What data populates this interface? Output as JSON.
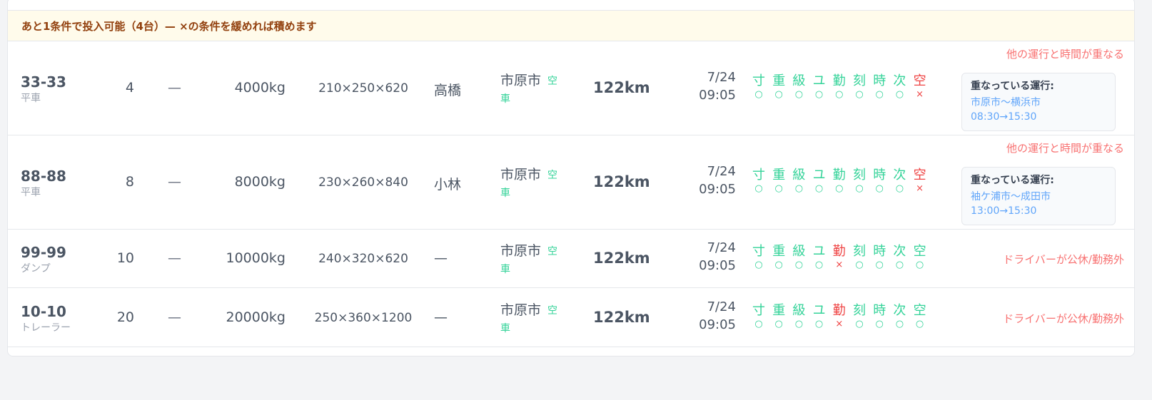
{
  "banner": "あと1条件で投入可能（4台）— ×の条件を緩めれば積めます",
  "check_labels": [
    "寸",
    "重",
    "級",
    "ユ",
    "勤",
    "刻",
    "時",
    "次",
    "空"
  ],
  "colors": {
    "ok": "#34d399",
    "ng": "#ef4444",
    "reason": "#f87171",
    "banner_bg": "#fffbeb"
  },
  "rows": [
    {
      "plate": "33-33",
      "type": "平車",
      "count": "4",
      "dash": "—",
      "weight": "4000kg",
      "dims": "210×250×620",
      "driver": "高橋",
      "city": "市原市",
      "status1": "空",
      "status2": "車",
      "distance": "122km",
      "date": "7/24",
      "time": "09:05",
      "checks": [
        "ok",
        "ok",
        "ok",
        "ok",
        "ok",
        "ok",
        "ok",
        "ok",
        "ng"
      ],
      "marks": [
        "○",
        "○",
        "○",
        "○",
        "○",
        "○",
        "○",
        "○",
        "×"
      ],
      "reason": "他の運行と時間が重なる",
      "conflict": {
        "heading": "重なっている運行:",
        "route": "市原市～横浜市",
        "time": "08:30→15:30"
      }
    },
    {
      "plate": "88-88",
      "type": "平車",
      "count": "8",
      "dash": "—",
      "weight": "8000kg",
      "dims": "230×260×840",
      "driver": "小林",
      "city": "市原市",
      "status1": "空",
      "status2": "車",
      "distance": "122km",
      "date": "7/24",
      "time": "09:05",
      "checks": [
        "ok",
        "ok",
        "ok",
        "ok",
        "ok",
        "ok",
        "ok",
        "ok",
        "ng"
      ],
      "marks": [
        "○",
        "○",
        "○",
        "○",
        "○",
        "○",
        "○",
        "○",
        "×"
      ],
      "reason": "他の運行と時間が重なる",
      "conflict": {
        "heading": "重なっている運行:",
        "route": "袖ケ浦市～成田市",
        "time": "13:00→15:30"
      }
    },
    {
      "plate": "99-99",
      "type": "ダンプ",
      "count": "10",
      "dash": "—",
      "weight": "10000kg",
      "dims": "240×320×620",
      "driver": "—",
      "city": "市原市",
      "status1": "空",
      "status2": "車",
      "distance": "122km",
      "date": "7/24",
      "time": "09:05",
      "checks": [
        "ok",
        "ok",
        "ok",
        "ok",
        "ng",
        "ok",
        "ok",
        "ok",
        "ok"
      ],
      "marks": [
        "○",
        "○",
        "○",
        "○",
        "×",
        "○",
        "○",
        "○",
        "○"
      ],
      "reason": "ドライバーが公休/勤務外"
    },
    {
      "plate": "10-10",
      "type": "トレーラー",
      "count": "20",
      "dash": "—",
      "weight": "20000kg",
      "dims": "250×360×1200",
      "driver": "—",
      "city": "市原市",
      "status1": "空",
      "status2": "車",
      "distance": "122km",
      "date": "7/24",
      "time": "09:05",
      "checks": [
        "ok",
        "ok",
        "ok",
        "ok",
        "ng",
        "ok",
        "ok",
        "ok",
        "ok"
      ],
      "marks": [
        "○",
        "○",
        "○",
        "○",
        "×",
        "○",
        "○",
        "○",
        "○"
      ],
      "reason": "ドライバーが公休/勤務外"
    }
  ]
}
